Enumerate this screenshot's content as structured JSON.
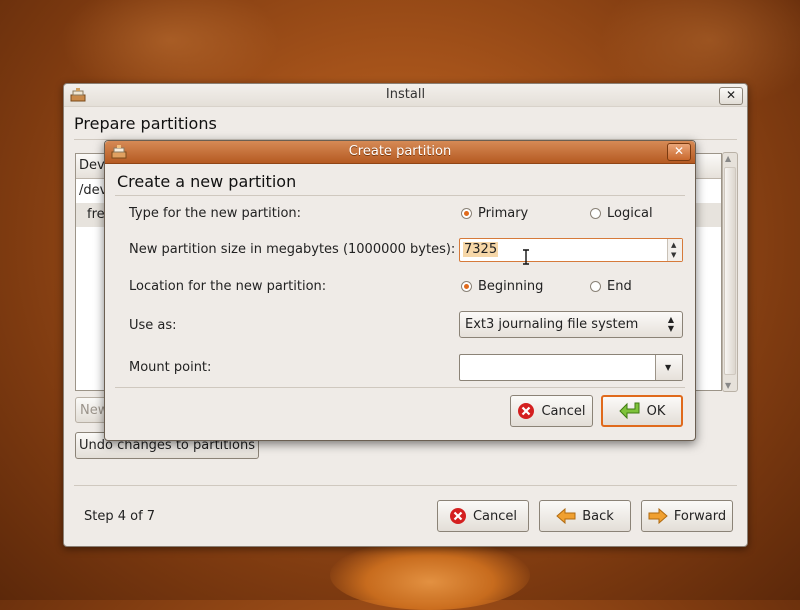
{
  "window": {
    "title": "Install",
    "close_label": "✕",
    "page_title": "Prepare partitions",
    "tree_header": "Dev",
    "tree_rows": [
      "/dev",
      "fre"
    ],
    "new_button": "New",
    "undo_button": "Undo changes to partitions",
    "step_label": "Step 4 of 7",
    "cancel_label": "Cancel",
    "back_label": "Back",
    "forward_label": "Forward"
  },
  "dialog": {
    "title": "Create partition",
    "close_label": "✕",
    "heading": "Create a new partition",
    "type_label": "Type for the new partition:",
    "type_options": [
      "Primary",
      "Logical"
    ],
    "type_selected": "Primary",
    "size_label": "New partition size in megabytes (1000000 bytes):",
    "size_value": "7325",
    "location_label": "Location for the new partition:",
    "location_options": [
      "Beginning",
      "End"
    ],
    "location_selected": "Beginning",
    "use_as_label": "Use as:",
    "use_as_value": "Ext3 journaling file system",
    "mount_label": "Mount point:",
    "mount_value": "",
    "cancel_label": "Cancel",
    "ok_label": "OK"
  },
  "colors": {
    "accent": "#e06a1c",
    "titlebar_active": "#c76d34",
    "window_bg": "#efebe7",
    "desktop": "#a4521a"
  },
  "icons": [
    "installer-app-icon",
    "close-icon",
    "cancel-icon",
    "back-arrow-icon",
    "forward-arrow-icon",
    "ok-check-icon",
    "spin-arrows-icon",
    "combo-arrows-icon",
    "dropdown-arrow-icon",
    "text-cursor-icon"
  ]
}
